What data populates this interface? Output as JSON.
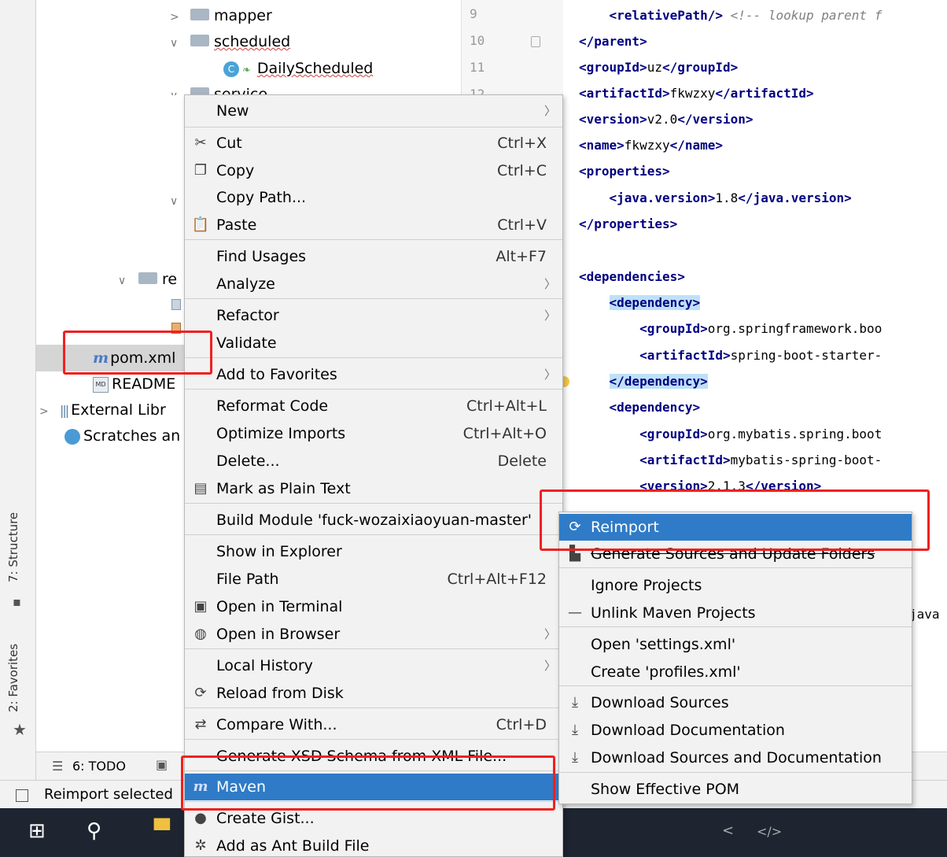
{
  "tree": {
    "items": [
      {
        "label": "mapper"
      },
      {
        "label": "scheduled"
      },
      {
        "label": "DailyScheduled"
      },
      {
        "label": "service"
      },
      {
        "label": "re"
      },
      {
        "label": "pom.xml"
      },
      {
        "label": "README"
      },
      {
        "label": "External Libr"
      },
      {
        "label": "Scratches an"
      }
    ]
  },
  "tool_strip": {
    "structure": "7: Structure",
    "favorites": "2: Favorites"
  },
  "gutter": {
    "lines": [
      "9",
      "10",
      "11",
      "12"
    ]
  },
  "editor": {
    "lines": [
      {
        "pre": "    ",
        "tag": "<relativePath/>",
        "text": " ",
        "comment": "<!-- lookup parent f"
      },
      {
        "pre": "",
        "tag": "</parent>",
        "text": "",
        "comment": ""
      },
      {
        "pre": "",
        "tag": "<groupId>",
        "text": "uz",
        "close": "</groupId>"
      },
      {
        "pre": "",
        "tag": "<artifactId>",
        "text": "fkwzxy",
        "close": "</artifactId>"
      },
      {
        "pre": "",
        "tag": "<version>",
        "text": "v2.0",
        "close": "</version>"
      },
      {
        "pre": "",
        "tag": "<name>",
        "text": "fkwzxy",
        "close": "</name>"
      },
      {
        "pre": "",
        "tag": "<properties>",
        "text": "",
        "close": ""
      },
      {
        "pre": "    ",
        "tag": "<java.version>",
        "text": "1.8",
        "close": "</java.version>"
      },
      {
        "pre": "",
        "tag": "</properties>",
        "text": "",
        "close": ""
      },
      {
        "pre": "",
        "tag": "",
        "text": "",
        "close": ""
      },
      {
        "pre": "",
        "tag": "<dependencies>",
        "text": "",
        "close": ""
      },
      {
        "pre": "    ",
        "tag": "<dependency>",
        "text": "",
        "close": ""
      },
      {
        "pre": "        ",
        "tag": "<groupId>",
        "text": "org.springframework.boo",
        "close": ""
      },
      {
        "pre": "        ",
        "tag": "<artifactId>",
        "text": "spring-boot-starter-",
        "close": ""
      },
      {
        "pre": "    ",
        "tag": "</dependency>",
        "text": "",
        "close": ""
      },
      {
        "pre": "    ",
        "tag": "<dependency>",
        "text": "",
        "close": ""
      },
      {
        "pre": "        ",
        "tag": "<groupId>",
        "text": "org.mybatis.spring.boot",
        "close": ""
      },
      {
        "pre": "        ",
        "tag": "<artifactId>",
        "text": "mybatis-spring-boot-",
        "close": ""
      },
      {
        "pre": "        ",
        "tag": "<version>",
        "text": "2.1.3",
        "close": "</version>"
      }
    ],
    "trailing": "java"
  },
  "context_menu": {
    "items": [
      {
        "label": "New",
        "shortcut": "",
        "submenu": true,
        "icon": ""
      },
      {
        "label": "Cut",
        "shortcut": "Ctrl+X",
        "submenu": false,
        "icon": "cut-icon"
      },
      {
        "label": "Copy",
        "shortcut": "Ctrl+C",
        "submenu": false,
        "icon": "copy-icon"
      },
      {
        "label": "Copy Path...",
        "shortcut": "",
        "submenu": false,
        "icon": ""
      },
      {
        "label": "Paste",
        "shortcut": "Ctrl+V",
        "submenu": false,
        "icon": "paste-icon"
      },
      {
        "label": "Find Usages",
        "shortcut": "Alt+F7",
        "submenu": false,
        "icon": ""
      },
      {
        "label": "Analyze",
        "shortcut": "",
        "submenu": true,
        "icon": ""
      },
      {
        "label": "Refactor",
        "shortcut": "",
        "submenu": true,
        "icon": ""
      },
      {
        "label": "Validate",
        "shortcut": "",
        "submenu": false,
        "icon": ""
      },
      {
        "label": "Add to Favorites",
        "shortcut": "",
        "submenu": true,
        "icon": ""
      },
      {
        "label": "Reformat Code",
        "shortcut": "Ctrl+Alt+L",
        "submenu": false,
        "icon": ""
      },
      {
        "label": "Optimize Imports",
        "shortcut": "Ctrl+Alt+O",
        "submenu": false,
        "icon": ""
      },
      {
        "label": "Delete...",
        "shortcut": "Delete",
        "submenu": false,
        "icon": ""
      },
      {
        "label": "Mark as Plain Text",
        "shortcut": "",
        "submenu": false,
        "icon": "plain-text-icon"
      },
      {
        "label": "Build Module 'fuck-wozaixiaoyuan-master'",
        "shortcut": "",
        "submenu": false,
        "icon": ""
      },
      {
        "label": "Show in Explorer",
        "shortcut": "",
        "submenu": false,
        "icon": ""
      },
      {
        "label": "File Path",
        "shortcut": "Ctrl+Alt+F12",
        "submenu": false,
        "icon": ""
      },
      {
        "label": "Open in Terminal",
        "shortcut": "",
        "submenu": false,
        "icon": "terminal-icon"
      },
      {
        "label": "Open in Browser",
        "shortcut": "",
        "submenu": true,
        "icon": "globe-icon"
      },
      {
        "label": "Local History",
        "shortcut": "",
        "submenu": true,
        "icon": ""
      },
      {
        "label": "Reload from Disk",
        "shortcut": "",
        "submenu": false,
        "icon": "reload-icon"
      },
      {
        "label": "Compare With...",
        "shortcut": "Ctrl+D",
        "submenu": false,
        "icon": "compare-icon"
      },
      {
        "label": "Generate XSD Schema from XML File...",
        "shortcut": "",
        "submenu": false,
        "icon": ""
      },
      {
        "label": "Maven",
        "shortcut": "",
        "submenu": false,
        "icon": "maven-icon"
      },
      {
        "label": "Create Gist...",
        "shortcut": "",
        "submenu": false,
        "icon": "github-icon"
      },
      {
        "label": "Add as Ant Build File",
        "shortcut": "",
        "submenu": false,
        "icon": "ant-icon"
      }
    ]
  },
  "submenu": {
    "items": [
      {
        "label": "Reimport",
        "icon": "reimport-icon"
      },
      {
        "label": "Generate Sources and Update Folders",
        "icon": "generate-icon"
      },
      {
        "label": "Ignore Projects",
        "icon": ""
      },
      {
        "label": "Unlink Maven Projects",
        "icon": "minus-icon"
      },
      {
        "label": "Open 'settings.xml'",
        "icon": ""
      },
      {
        "label": "Create 'profiles.xml'",
        "icon": ""
      },
      {
        "label": "Download Sources",
        "icon": "download-icon"
      },
      {
        "label": "Download Documentation",
        "icon": "download-icon"
      },
      {
        "label": "Download Sources and Documentation",
        "icon": "download-icon"
      },
      {
        "label": "Show Effective POM",
        "icon": ""
      }
    ]
  },
  "bottom_tools": {
    "todo": "6: TODO"
  },
  "status_bar": {
    "text": "Reimport selected"
  },
  "colors": {
    "accent": "#2f7bc7",
    "highlight_box": "#f02020",
    "xml_tag": "#000080"
  }
}
